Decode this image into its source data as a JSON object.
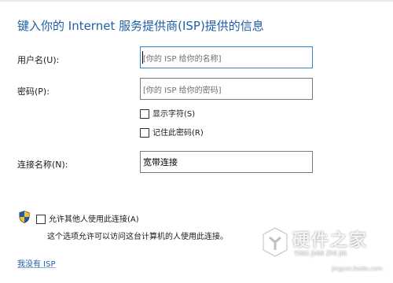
{
  "title": "键入你的 Internet 服务提供商(ISP)提供的信息",
  "form": {
    "username_label": "用户名(U):",
    "username_placeholder": "[你的 ISP 给你的名称]",
    "password_label": "密码(P):",
    "password_placeholder": "[你的 ISP 给你的密码]",
    "show_chars_label": "显示字符(S)",
    "remember_password_label": "记住此密码(R)",
    "connection_name_label": "连接名称(N):",
    "connection_name_value": "宽带连接"
  },
  "sharing": {
    "allow_label": "允许其他人使用此连接(A)",
    "description": "这个选项允许可以访问这台计算机的人使用此连接。"
  },
  "links": {
    "no_isp": "我没有 ISP"
  },
  "watermark": {
    "title": "硬件之家",
    "subtitle": "YING JIAN ZHI JIA",
    "url": "jingyan.baidu.com"
  },
  "colors": {
    "title": "#1f5fa8",
    "focus_border": "#2f86d6"
  },
  "icons": {
    "shield": "uac-shield-icon"
  }
}
